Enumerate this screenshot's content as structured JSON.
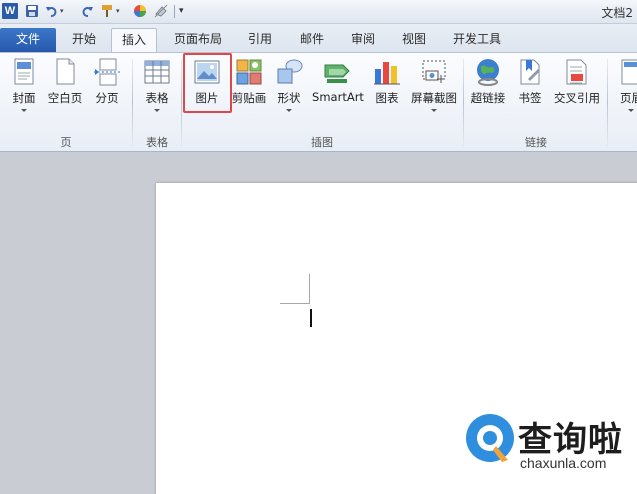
{
  "titlebar": {
    "app_logo": "W",
    "doc_title": "文档2",
    "quick_access": [
      "save-icon",
      "undo-icon",
      "redo-icon",
      "format-painter-icon",
      "color-wheel-icon",
      "eraser-icon",
      "customize-icon"
    ]
  },
  "tabs": [
    {
      "label": "文件",
      "active": false
    },
    {
      "label": "开始",
      "active": false
    },
    {
      "label": "插入",
      "active": true
    },
    {
      "label": "页面布局",
      "active": false
    },
    {
      "label": "引用",
      "active": false
    },
    {
      "label": "邮件",
      "active": false
    },
    {
      "label": "审阅",
      "active": false
    },
    {
      "label": "视图",
      "active": false
    },
    {
      "label": "开发工具",
      "active": false
    }
  ],
  "ribbon": {
    "groups": [
      {
        "label": "页",
        "buttons": [
          "封面",
          "空白页",
          "分页"
        ]
      },
      {
        "label": "表格",
        "buttons": [
          "表格"
        ]
      },
      {
        "label": "插图",
        "buttons": [
          "图片",
          "剪贴画",
          "形状",
          "SmartArt",
          "图表",
          "屏幕截图"
        ]
      },
      {
        "label": "链接",
        "buttons": [
          "超链接",
          "书签",
          "交叉引用"
        ]
      }
    ],
    "cut_off_button": "页眉",
    "highlighted_button": "图片",
    "highlight_color": "#e0474a"
  },
  "watermark": {
    "name": "查询啦",
    "url": "chaxunla.com",
    "accent": "#2f8fde"
  }
}
